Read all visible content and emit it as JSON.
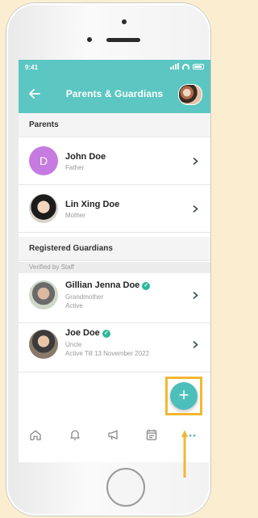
{
  "status_bar": {
    "time": "9:41"
  },
  "header": {
    "title": "Parents & Guardians"
  },
  "sections": {
    "parents": "Parents",
    "registered": "Registered Guardians",
    "verified_by": "Verified by Staff"
  },
  "parents": [
    {
      "initial": "D",
      "name": "John Doe",
      "relation": "Father"
    },
    {
      "name": "Lin Xing Doe",
      "relation": "Mother"
    }
  ],
  "guardians": [
    {
      "name": "Gillian Jenna Doe",
      "relation": "Grandmother",
      "status": "Active"
    },
    {
      "name": "Joe Doe",
      "relation": "Uncle",
      "status": "Active Till 13 November 2022"
    }
  ],
  "fab": {
    "label": "+"
  },
  "colors": {
    "header": "#5bc6c2",
    "fab": "#4cbfbb",
    "avatar_initial": "#c67be0",
    "verified": "#2eb79a",
    "highlight": "#f5b731"
  },
  "icons": [
    "back-arrow-icon",
    "chevron-right-icon",
    "verified-check-icon",
    "home-icon",
    "bell-icon",
    "megaphone-icon",
    "calendar-icon",
    "more-icon",
    "plus-icon"
  ]
}
